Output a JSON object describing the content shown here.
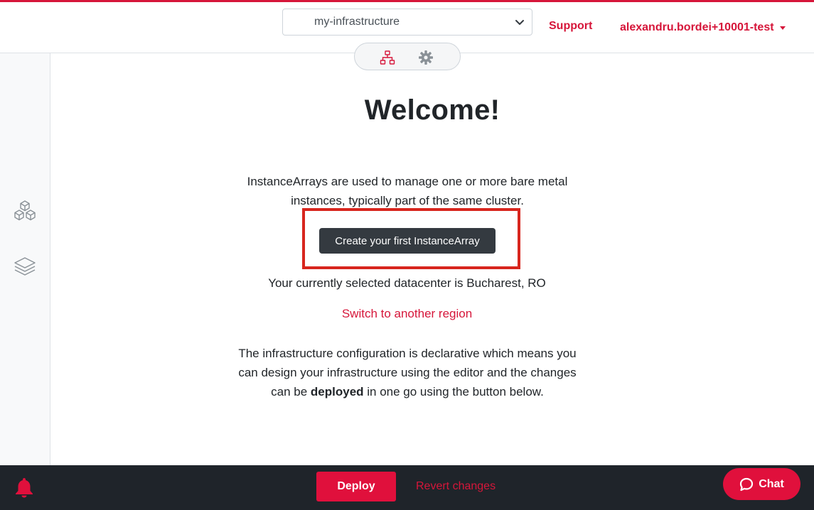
{
  "header": {
    "infrastructure_select": {
      "selected": "my-infrastructure"
    },
    "support_label": "Support",
    "user_label": "alexandru.bordei+10001-test"
  },
  "view_switch": {
    "items": [
      {
        "icon": "network-topology-icon",
        "active": true
      },
      {
        "icon": "gear-icon",
        "active": false
      }
    ]
  },
  "sidebar": {
    "items": [
      {
        "icon": "cubes-icon"
      },
      {
        "icon": "layers-icon"
      }
    ]
  },
  "main": {
    "title": "Welcome!",
    "description": "InstanceArrays are used to manage one or more bare metal instances, typically part of the same cluster.",
    "create_button_label": "Create your first InstanceArray",
    "datacenter_text": "Your currently selected datacenter is Bucharest, RO",
    "switch_region_label": "Switch to another region",
    "declarative": {
      "part1": "The infrastructure configuration is declarative which means you can design your infrastructure using the editor and the changes can be ",
      "bold": "deployed",
      "part2": " in one go using the button below."
    }
  },
  "footer": {
    "deploy_label": "Deploy",
    "revert_label": "Revert changes",
    "chat_label": "Chat"
  },
  "colors": {
    "accent": "#d6163a",
    "button_primary": "#e0103c",
    "dark_button": "#343a40",
    "footer_bg": "#1f242a",
    "highlight": "#d8261e"
  }
}
